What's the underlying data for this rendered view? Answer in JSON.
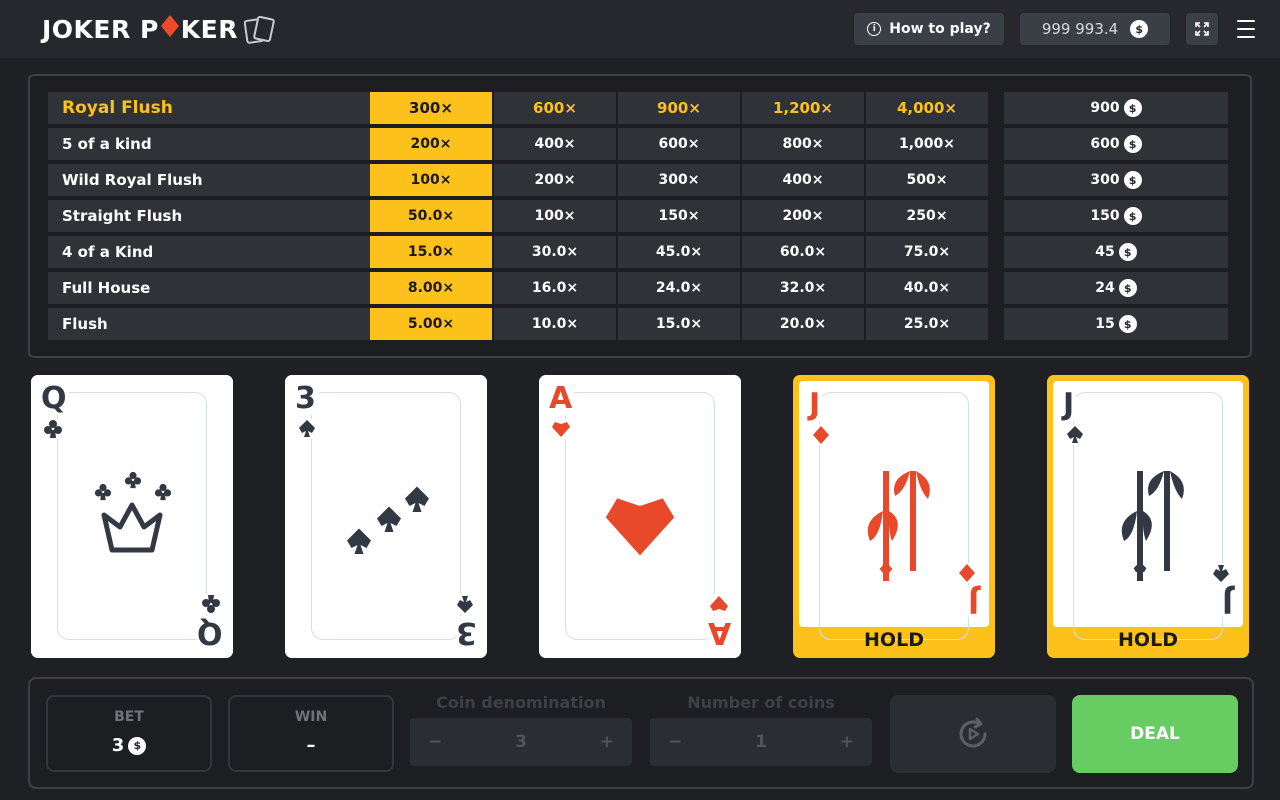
{
  "header": {
    "logo_text_1": "JOKER P",
    "logo_text_2": "KER",
    "how_to_play": "How to play?",
    "balance": "999 993.4",
    "currency_symbol": "$"
  },
  "paytable": {
    "active_column": 0,
    "rows": [
      {
        "name": "Royal Flush",
        "payouts": [
          "300×",
          "600×",
          "900×",
          "1,200×",
          "4,000×"
        ],
        "win": "900"
      },
      {
        "name": "5 of a kind",
        "payouts": [
          "200×",
          "400×",
          "600×",
          "800×",
          "1,000×"
        ],
        "win": "600"
      },
      {
        "name": "Wild Royal Flush",
        "payouts": [
          "100×",
          "200×",
          "300×",
          "400×",
          "500×"
        ],
        "win": "300"
      },
      {
        "name": "Straight Flush",
        "payouts": [
          "50.0×",
          "100×",
          "150×",
          "200×",
          "250×"
        ],
        "win": "150"
      },
      {
        "name": "4 of a Kind",
        "payouts": [
          "15.0×",
          "30.0×",
          "45.0×",
          "60.0×",
          "75.0×"
        ],
        "win": "45"
      },
      {
        "name": "Full House",
        "payouts": [
          "8.00×",
          "16.0×",
          "24.0×",
          "32.0×",
          "40.0×"
        ],
        "win": "24"
      },
      {
        "name": "Flush",
        "payouts": [
          "5.00×",
          "10.0×",
          "15.0×",
          "20.0×",
          "25.0×"
        ],
        "win": "15"
      }
    ]
  },
  "cards": [
    {
      "rank": "Q",
      "suit": "clubs",
      "color": "dark",
      "held": false
    },
    {
      "rank": "3",
      "suit": "spades",
      "color": "dark",
      "held": false
    },
    {
      "rank": "A",
      "suit": "hearts",
      "color": "red",
      "held": false
    },
    {
      "rank": "J",
      "suit": "diamonds",
      "color": "red",
      "held": true
    },
    {
      "rank": "J",
      "suit": "spades",
      "color": "dark",
      "held": true
    }
  ],
  "hold_label": "HOLD",
  "controls": {
    "bet_label": "BET",
    "bet_value": "3",
    "win_label": "WIN",
    "win_value": "–",
    "coin_denomination_label": "Coin denomination",
    "coin_denomination_value": "3",
    "number_of_coins_label": "Number of coins",
    "number_of_coins_value": "1",
    "minus": "−",
    "plus": "+",
    "deal_label": "DEAL"
  },
  "colors": {
    "accent": "#fcc21b",
    "deal": "#67cd62",
    "red_suit": "#e8492a",
    "dark_suit": "#333845"
  }
}
